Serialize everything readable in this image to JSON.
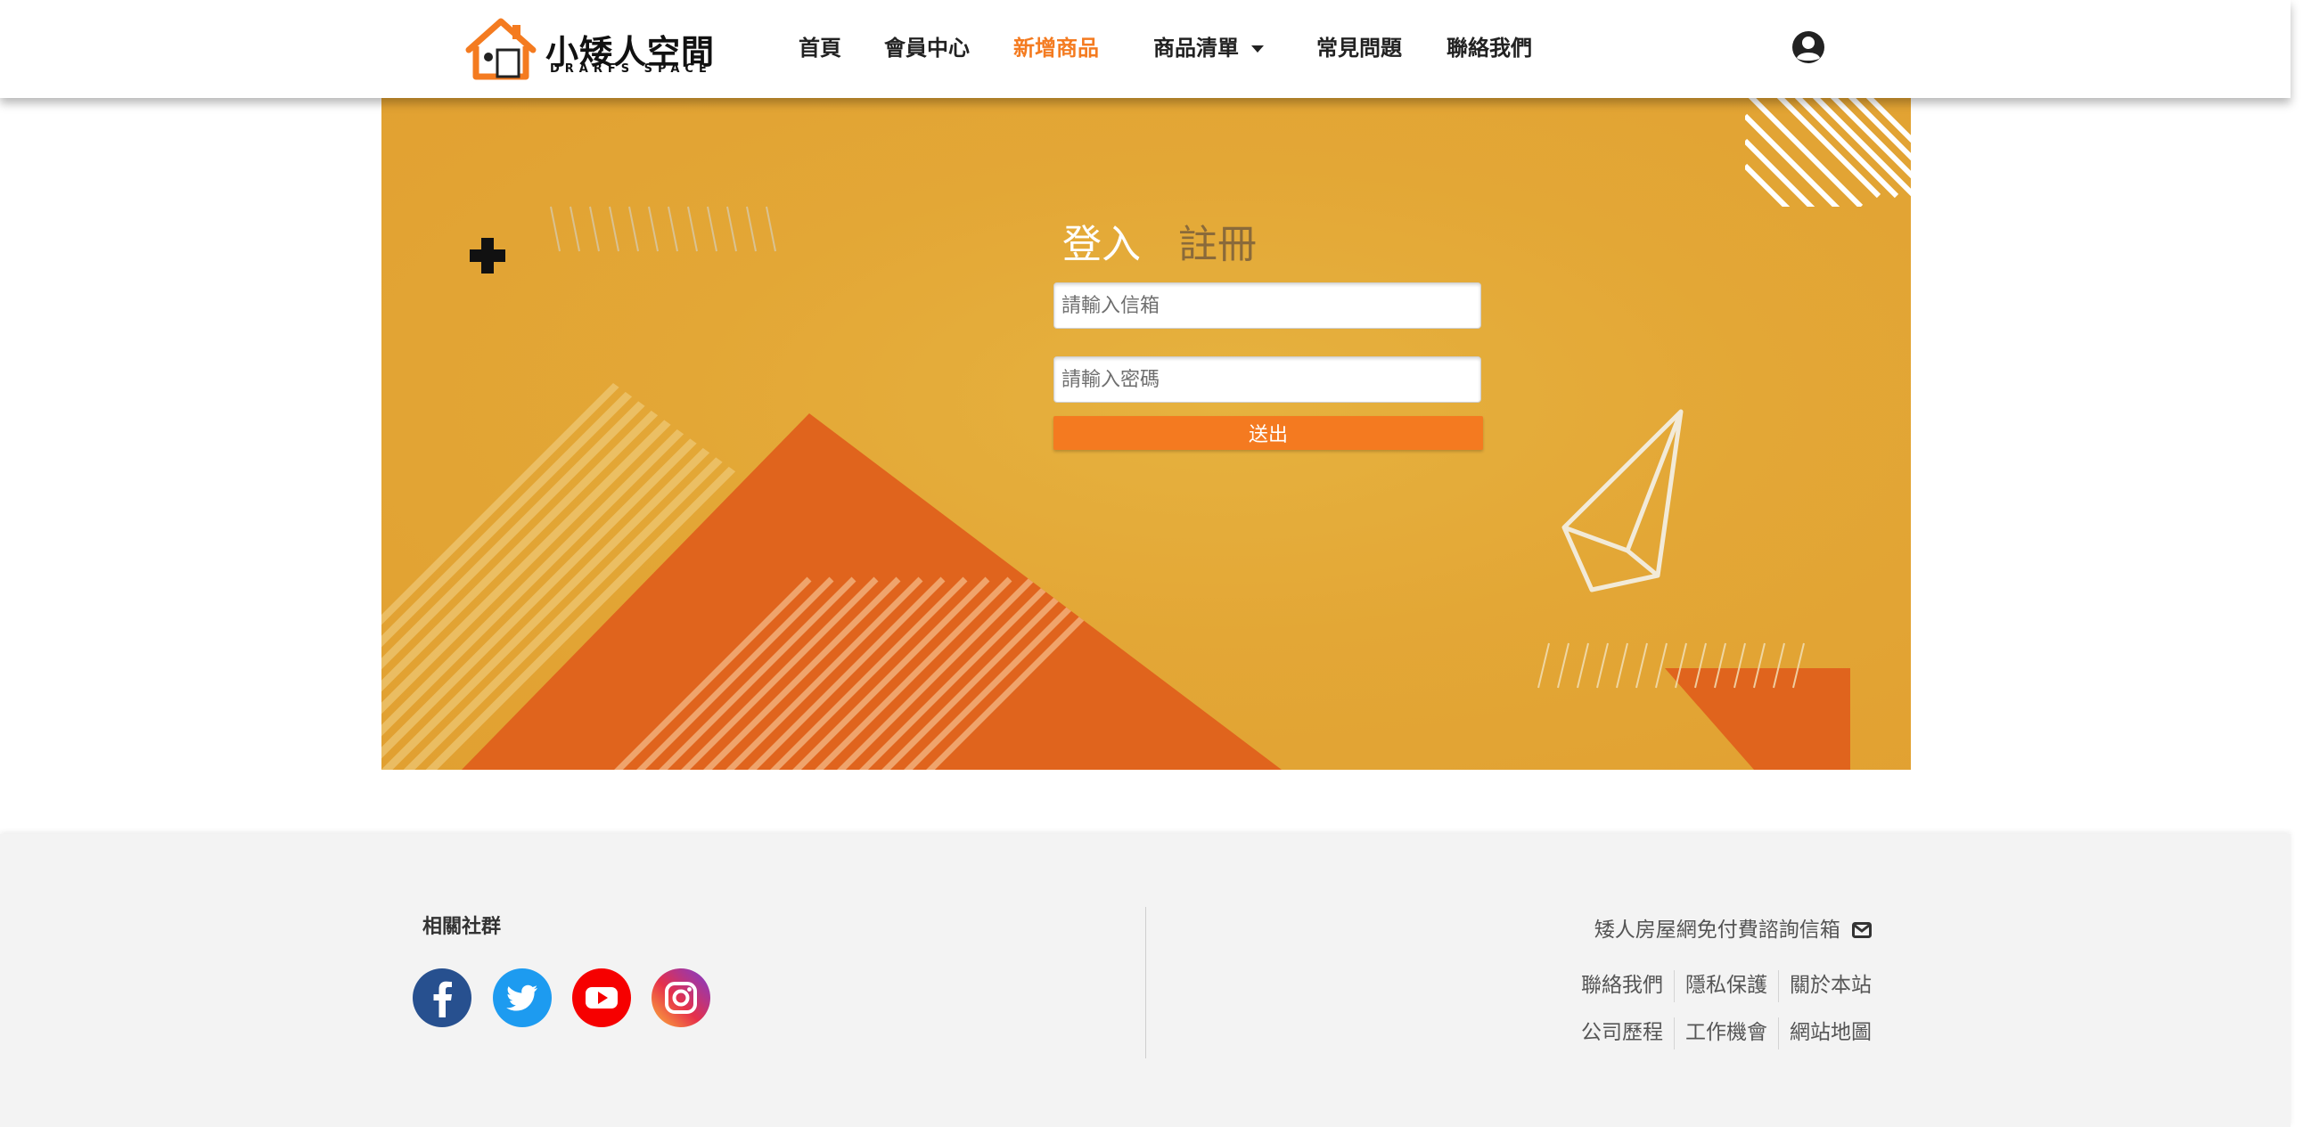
{
  "brand": {
    "name": "小矮人空間",
    "subtitle": "DRARFS SPACE",
    "color": "#f47b20"
  },
  "nav": {
    "items": [
      {
        "label": "首頁",
        "active": false
      },
      {
        "label": "會員中心",
        "active": false
      },
      {
        "label": "新增商品",
        "active": true
      },
      {
        "label": "商品清單",
        "active": false,
        "dropdown": true
      },
      {
        "label": "常見問題",
        "active": false
      },
      {
        "label": "聯絡我們",
        "active": false
      }
    ],
    "user_icon": "user-circle-icon"
  },
  "auth": {
    "tab_login": "登入",
    "tab_register": "註冊",
    "email_placeholder": "請輸入信箱",
    "email_value": "",
    "password_placeholder": "請輸入密碼",
    "password_value": "",
    "submit_label": "送出"
  },
  "footer": {
    "social_title": "相關社群",
    "social_icons": [
      "facebook-icon",
      "twitter-icon",
      "youtube-icon",
      "instagram-icon"
    ],
    "contact_text": "矮人房屋網免付費諮詢信箱",
    "links_row1": [
      "聯絡我們",
      "隱私保護",
      "關於本站"
    ],
    "links_row2": [
      "公司歷程",
      "工作機會",
      "網站地圖"
    ]
  },
  "colors": {
    "accent": "#f47b20",
    "hero_bg": "#e3a736",
    "hero_dark": "#e0641d",
    "footer_bg": "#f3f3f3"
  }
}
